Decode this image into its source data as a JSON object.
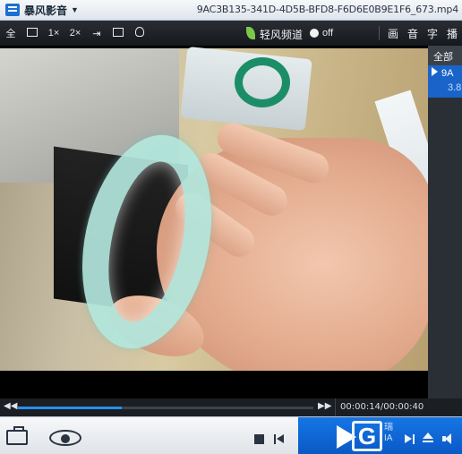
{
  "title_bar": {
    "app_name": "暴风影音",
    "file_name": "9AC3B135-341D-4D5B-BFD8-F6D6E0B9E1F6_673.mp4"
  },
  "toolbar": {
    "fullscreen": "全",
    "size_1x": "1×",
    "size_2x": "2×",
    "channel_label": "轻风频道",
    "toggle_state": "off",
    "right_buttons": [
      "画",
      "音",
      "字",
      "播"
    ]
  },
  "playlist": {
    "header": "全部",
    "item_title": "9A",
    "item_sub": "3.8"
  },
  "progress": {
    "current_time": "00:00:14",
    "total_time": "00:00:40",
    "time_display": "00:00:14/00:00:40",
    "fraction": 0.35
  },
  "controls": {
    "watermark_letter": "G",
    "watermark_text": "瑞",
    "watermark_sub": "IA"
  },
  "icons": {
    "app": "storm-logo-icon",
    "eye": "eye-icon",
    "toolbox": "toolbox-icon",
    "stop": "stop-icon",
    "prev": "previous-icon",
    "play": "play-icon",
    "next": "next-icon",
    "eject": "eject-icon",
    "volume": "volume-icon"
  },
  "colors": {
    "accent": "#1a64c9",
    "progress_fill": "#2a8cf0"
  }
}
